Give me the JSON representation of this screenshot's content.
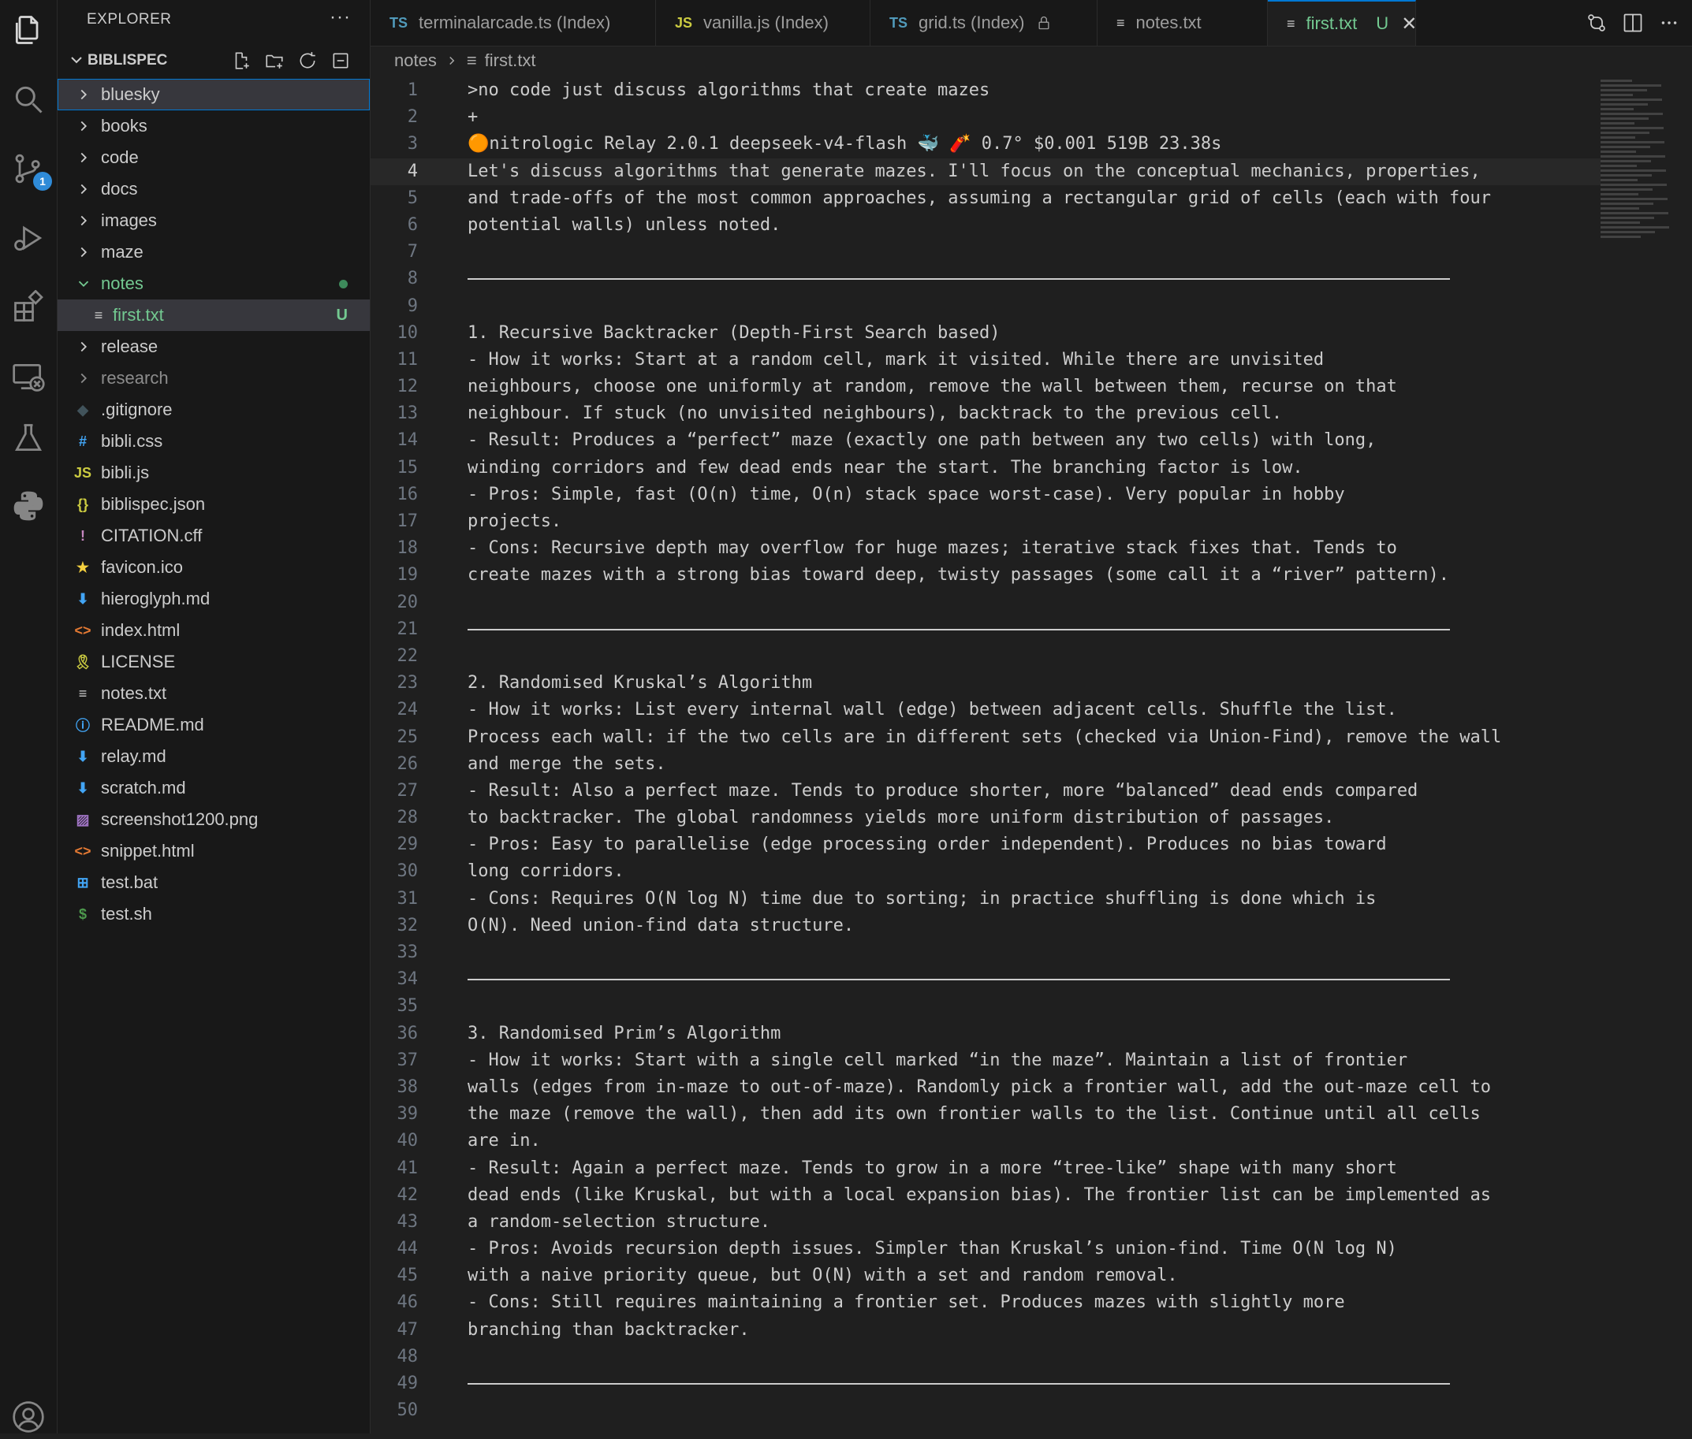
{
  "activity_bar": {
    "scm_badge": "1"
  },
  "explorer": {
    "title": "EXPLORER",
    "more": "···",
    "workspace": "BIBLISPEC",
    "folders": [
      {
        "label": "bluesky"
      },
      {
        "label": "books"
      },
      {
        "label": "code"
      },
      {
        "label": "docs"
      },
      {
        "label": "images"
      },
      {
        "label": "maze"
      }
    ],
    "open_folder": {
      "label": "notes",
      "child_label": "first.txt",
      "child_status": "U"
    },
    "more_folders": [
      {
        "label": "release"
      },
      {
        "label": "research"
      }
    ],
    "files": [
      {
        "label": ".gitignore",
        "icon": "git-icon",
        "glyph": "◆",
        "color": "#41535b"
      },
      {
        "label": "bibli.css",
        "icon": "css-hash-icon",
        "glyph": "#",
        "color": "#42a5f5"
      },
      {
        "label": "bibli.js",
        "icon": "js-icon",
        "glyph": "JS",
        "color": "#cbcb41"
      },
      {
        "label": "biblispec.json",
        "icon": "json-braces-icon",
        "glyph": "{}",
        "color": "#cbcb41"
      },
      {
        "label": "CITATION.cff",
        "icon": "exclamation-icon",
        "glyph": "!",
        "color": "#c586c0"
      },
      {
        "label": "favicon.ico",
        "icon": "star-icon",
        "glyph": "★",
        "color": "#f4d03f"
      },
      {
        "label": "hieroglyph.md",
        "icon": "markdown-arrow-icon",
        "glyph": "⬇",
        "color": "#42a5f5"
      },
      {
        "label": "index.html",
        "icon": "html-brackets-icon",
        "glyph": "<>",
        "color": "#e37933"
      },
      {
        "label": "LICENSE",
        "icon": "license-ribbon-icon",
        "glyph": "🎗",
        "color": "#cbcb41"
      },
      {
        "label": "notes.txt",
        "icon": "text-lines-icon",
        "glyph": "≡",
        "color": "#cccccc"
      },
      {
        "label": "README.md",
        "icon": "info-icon",
        "glyph": "ⓘ",
        "color": "#42a5f5"
      },
      {
        "label": "relay.md",
        "icon": "markdown-arrow-icon",
        "glyph": "⬇",
        "color": "#42a5f5"
      },
      {
        "label": "scratch.md",
        "icon": "markdown-arrow-icon",
        "glyph": "⬇",
        "color": "#42a5f5"
      },
      {
        "label": "screenshot1200.png",
        "icon": "image-icon",
        "glyph": "▨",
        "color": "#a074c4"
      },
      {
        "label": "snippet.html",
        "icon": "html-brackets-icon",
        "glyph": "<>",
        "color": "#e37933"
      },
      {
        "label": "test.bat",
        "icon": "windows-icon",
        "glyph": "⊞",
        "color": "#42a5f5"
      },
      {
        "label": "test.sh",
        "icon": "dollar-icon",
        "glyph": "$",
        "color": "#4d9a4d"
      }
    ]
  },
  "tabs": [
    {
      "prefix": "TS",
      "label": "terminalarcade.ts (Index)"
    },
    {
      "prefix": "JS",
      "label": "vanilla.js (Index)"
    },
    {
      "prefix": "TS",
      "label": "grid.ts (Index)"
    },
    {
      "prefix": "≡",
      "label": "notes.txt"
    },
    {
      "prefix": "≡",
      "label": "first.txt",
      "status": "U",
      "close": "✕"
    }
  ],
  "breadcrumb": {
    "folder": "notes",
    "file_icon": "≡",
    "file": "first.txt"
  },
  "editor": {
    "current_line": 4,
    "lines": [
      ">no code just discuss algorithms that create mazes",
      "+",
      "🟠nitrologic Relay 2.0.1 deepseek-v4-flash 🐳 🧨 0.7° $0.001 519B 23.38s",
      "Let's discuss algorithms that generate mazes. I'll focus on the conceptual mechanics, properties,",
      "and trade-offs of the most common approaches, assuming a rectangular grid of cells (each with four",
      "potential walls) unless noted.",
      "",
      "---",
      "",
      "1. Recursive Backtracker (Depth-First Search based)",
      "- How it works: Start at a random cell, mark it visited. While there are unvisited",
      "neighbours, choose one uniformly at random, remove the wall between them, recurse on that",
      "neighbour. If stuck (no unvisited neighbours), backtrack to the previous cell.",
      "- Result: Produces a “perfect” maze (exactly one path between any two cells) with long,",
      "winding corridors and few dead ends near the start. The branching factor is low.",
      "- Pros: Simple, fast (O(n) time, O(n) stack space worst-case). Very popular in hobby",
      "projects.",
      "- Cons: Recursive depth may overflow for huge mazes; iterative stack fixes that. Tends to",
      "create mazes with a strong bias toward deep, twisty passages (some call it a “river” pattern).",
      "",
      "---",
      "",
      "2. Randomised Kruskal’s Algorithm",
      "- How it works: List every internal wall (edge) between adjacent cells. Shuffle the list.",
      "Process each wall: if the two cells are in different sets (checked via Union-Find), remove the wall",
      "and merge the sets.",
      "- Result: Also a perfect maze. Tends to produce shorter, more “balanced” dead ends compared",
      "to backtracker. The global randomness yields more uniform distribution of passages.",
      "- Pros: Easy to parallelise (edge processing order independent). Produces no bias toward",
      "long corridors.",
      "- Cons: Requires O(N log N) time due to sorting; in practice shuffling is done which is",
      "O(N). Need union-find data structure.",
      "",
      "---",
      "",
      "3. Randomised Prim’s Algorithm",
      "- How it works: Start with a single cell marked “in the maze”. Maintain a list of frontier",
      "walls (edges from in-maze to out-of-maze). Randomly pick a frontier wall, add the out-maze cell to",
      "the maze (remove the wall), then add its own frontier walls to the list. Continue until all cells",
      "are in.",
      "- Result: Again a perfect maze. Tends to grow in a more “tree-like” shape with many short",
      "dead ends (like Kruskal, but with a local expansion bias). The frontier list can be implemented as",
      "a random-selection structure.",
      "- Pros: Avoids recursion depth issues. Simpler than Kruskal’s union-find. Time O(N log N)",
      "with a naive priority queue, but O(N) with a set and random removal.",
      "- Cons: Still requires maintaining a frontier set. Produces mazes with slightly more",
      "branching than backtracker.",
      "",
      "---",
      ""
    ]
  }
}
